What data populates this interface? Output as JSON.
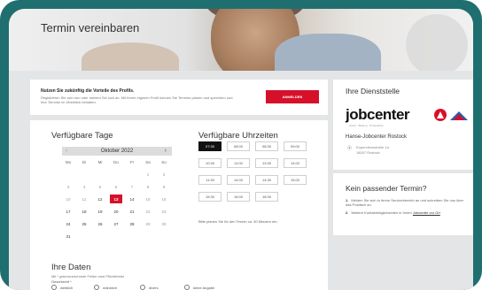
{
  "hero": {
    "title": "Termin vereinbaren"
  },
  "profil": {
    "headline": "Nutzen Sie zukünftig die Vorteile des Profils.",
    "text": "Registrieren Sie sich neu oder melden Sie sich an. Mit Ihrem eigenen Profil können Sie Termine planen und speichern und Ihre Termine im Überblick behalten.",
    "button": "ANMELDEN"
  },
  "tage": {
    "title": "Verfügbare Tage",
    "month": "Oktober 2022",
    "prev": "‹",
    "next": "›",
    "weekdays": [
      "Mo",
      "Di",
      "Mi",
      "Do",
      "Fr",
      "Sa",
      "So"
    ],
    "weeks": [
      [
        "",
        "",
        "",
        "",
        "",
        "1",
        "2"
      ],
      [
        "3",
        "4",
        "5",
        "6",
        "7",
        "8",
        "9"
      ],
      [
        "10",
        "11",
        "12",
        "13",
        "14",
        "15",
        "16"
      ],
      [
        "17",
        "18",
        "19",
        "20",
        "21",
        "22",
        "23"
      ],
      [
        "24",
        "25",
        "26",
        "27",
        "28",
        "29",
        "30"
      ],
      [
        "31",
        "",
        "",
        "",
        "",
        "",
        ""
      ]
    ],
    "available": [
      "12",
      "13",
      "14",
      "17",
      "18",
      "19",
      "20",
      "21",
      "24",
      "25",
      "26",
      "27",
      "28",
      "31"
    ],
    "selected": "13"
  },
  "uhrzeiten": {
    "title": "Verfügbare Uhrzeiten",
    "slots": [
      "07:30",
      "08:00",
      "08:30",
      "09:00",
      "10:30",
      "11:00",
      "13:30",
      "14:00",
      "11:30",
      "14:00",
      "14:30",
      "15:00",
      "15:30",
      "16:00",
      "16:30"
    ],
    "selected": "07:30",
    "note": "Bitte planen Sie für den Termin ca. 30 Minuten ein."
  },
  "daten": {
    "title": "Ihre Daten",
    "note": "Mit * gekennzeichnete Felder sind Pflichtfelder",
    "salutation_label": "Geschlecht *",
    "options": [
      "weiblich",
      "männlich",
      "divers",
      "keine Angabe"
    ]
  },
  "dienststelle": {
    "title": "Ihre Dienststelle",
    "logo_text": "jobcenter",
    "logo_tagline": "Arbeit · Bildung · Perspektive",
    "office": "Hanse-Jobcenter Rostock",
    "street": "Kopernikusstraße 1a",
    "city": "18057 Rostock"
  },
  "kein_termin": {
    "title": "Kein passender Termin?",
    "items": [
      {
        "num": "1.",
        "text": "Melden Sie sich in Ihrem Servicebereich an und schreiben Sie uns über das Postfach an."
      },
      {
        "num": "2.",
        "text": "Weitere Kontaktmöglichkeiten in Ihrem",
        "link": "Jobcenter vor Ort"
      }
    ]
  },
  "colors": {
    "accent": "#d6102a",
    "frame": "#1f6f70",
    "selected_time": "#111111"
  }
}
